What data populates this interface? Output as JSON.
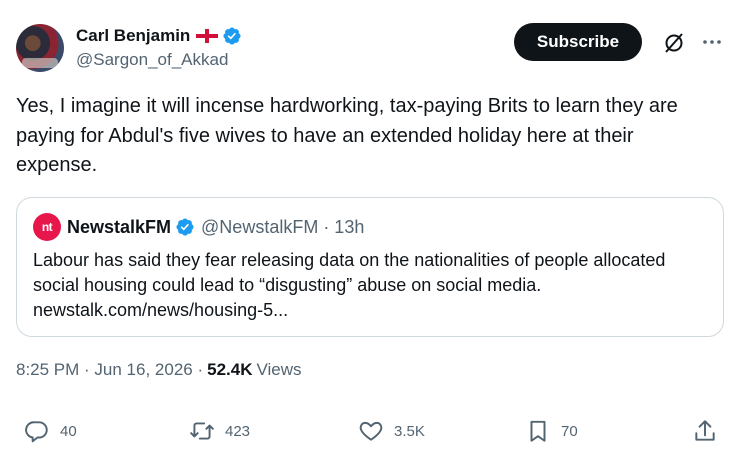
{
  "author": {
    "display_name": "Carl Benjamin",
    "handle": "@Sargon_of_Akkad",
    "flag": "england-flag",
    "verified": true
  },
  "header": {
    "subscribe_label": "Subscribe"
  },
  "tweet": {
    "text": "Yes, I imagine it will incense hardworking, tax-paying Brits to learn they are paying for Abdul's five wives to have an extended holiday here at their expense."
  },
  "quote": {
    "logo_text": "nt",
    "display_name": "NewstalkFM",
    "handle_time": "@NewstalkFM · 13h",
    "text": "Labour has said they fear releasing data on the nationalities of people allocated social housing could lead to “disgusting” abuse on social media. newstalk.com/news/housing-5..."
  },
  "meta": {
    "timestamp": "8:25 PM · Jun 16, 2026 ·",
    "views_count": "52.4K",
    "views_label": "Views"
  },
  "actions": {
    "replies": "40",
    "reposts": "423",
    "likes": "3.5K",
    "bookmarks": "70"
  },
  "colors": {
    "text": "#0f1419",
    "secondary": "#536471",
    "verified": "#1d9bf0",
    "border": "#cfd9de",
    "newstalk_brand": "#e8174b"
  }
}
